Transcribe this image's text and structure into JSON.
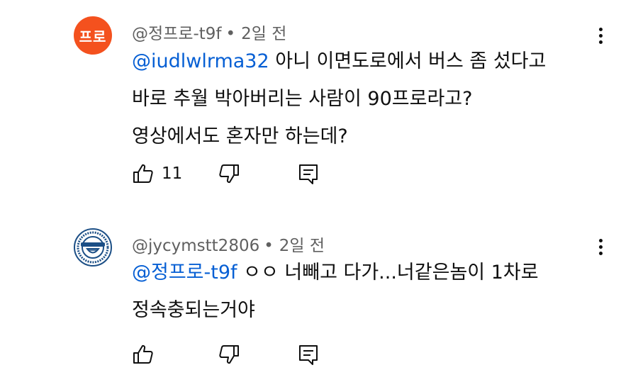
{
  "comments": [
    {
      "avatar_text": "프로",
      "avatar_color": "#f4511e",
      "author": "@정프로-t9f",
      "separator": "•",
      "time": "2일 전",
      "mention": "@iudlwlrma32",
      "lines": [
        " 아니 이면도로에서 버스 좀 섰다고",
        "바로 추월 박아버리는 사람이 90프로라고?",
        "영상에서도 혼자만 하는데?"
      ],
      "like_count": "11",
      "icons": {
        "like": "thumbs-up-icon",
        "dislike": "thumbs-down-icon",
        "reply": "reply-icon",
        "more": "more-vertical-icon"
      }
    },
    {
      "avatar_icon": "laughing-man-logo",
      "author": "@jycymstt2806",
      "separator": "•",
      "time": "2일 전",
      "mention": "@정프로-t9f",
      "lines": [
        " ㅇㅇ 너빼고 다가...너같은놈이 1차로",
        "정속충되는거야"
      ],
      "like_count": "",
      "icons": {
        "like": "thumbs-up-icon",
        "dislike": "thumbs-down-icon",
        "reply": "reply-icon",
        "more": "more-vertical-icon"
      }
    }
  ],
  "colors": {
    "mention": "#065fd4",
    "meta": "#606060",
    "text": "#0f0f0f"
  }
}
